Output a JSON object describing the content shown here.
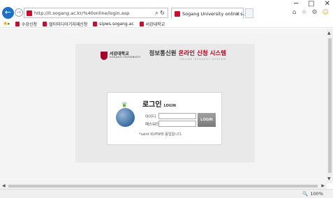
{
  "browser": {
    "url": "http://it.sogang.ac.kr/%40online/login.asp",
    "tab_title": "Sogang University online s...",
    "favorites": [
      {
        "label": "수강신청"
      },
      {
        "label": "멀티미디어기자재신청"
      },
      {
        "label": "sipws.sogang.ac"
      },
      {
        "label": "서강대학교"
      }
    ],
    "zoom": "100%"
  },
  "icons": {
    "back": "←",
    "forward": "→",
    "search": "⌕",
    "refresh": "↻",
    "close": "×",
    "home": "⌂",
    "star": "☆",
    "gear": "⚙",
    "smile": "☺",
    "minimize": "─",
    "maximize": "□",
    "window_close": "✕",
    "fav_star": "★",
    "add_fav": "▸",
    "arrow_up": "▲",
    "arrow_down": "▼",
    "arrow_left": "◀",
    "arrow_right": "▶",
    "zoom": "🔍",
    "leaf": "❦"
  },
  "header": {
    "university_ko": "서강대학교",
    "university_en": "SOGANG UNIVERSITY",
    "system_prefix": "정보통신원",
    "system_title": "온라인 신청 시스템",
    "system_sub": "ONLINE REQUEST SYSTEM"
  },
  "login": {
    "heading_ko": "로그인",
    "heading_en": "LOGIN",
    "id_label": "아이디",
    "pw_label": "패스워드",
    "button_label": "LOGIN",
    "note": "*saint ID/PW와 동일합니다."
  },
  "colors": {
    "brand": "#b3001b",
    "browser_accent": "#1f6fc5"
  }
}
